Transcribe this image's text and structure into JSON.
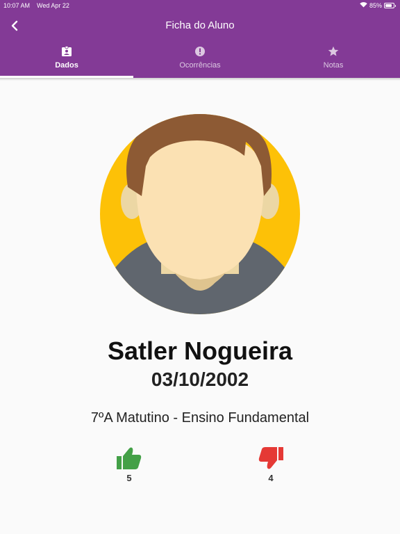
{
  "status_bar": {
    "time": "10:07 AM",
    "date": "Wed Apr 22",
    "battery": "85%",
    "battery_level": 0.85
  },
  "app_bar": {
    "title": "Ficha do Aluno",
    "color": "#833a96"
  },
  "tabs": [
    {
      "label": "Dados",
      "icon": "badge-icon",
      "active": true
    },
    {
      "label": "Ocorrências",
      "icon": "alert-circle-icon",
      "active": false
    },
    {
      "label": "Notas",
      "icon": "star-icon",
      "active": false
    }
  ],
  "student": {
    "name": "Satler Nogueira",
    "birth_date": "03/10/2002",
    "class_info": "7ºA Matutino - Ensino Fundamental",
    "avatar_icon": "student-avatar"
  },
  "ratings": {
    "positive": {
      "count": "5",
      "icon": "thumbs-up-icon",
      "color": "#43a047"
    },
    "negative": {
      "count": "4",
      "icon": "thumbs-down-icon",
      "color": "#e53935"
    }
  }
}
